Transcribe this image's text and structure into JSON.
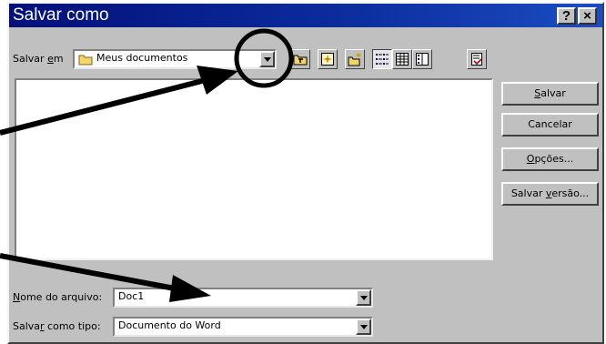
{
  "window": {
    "title": "Salvar como",
    "help_label": "?",
    "close_label": "×"
  },
  "location": {
    "label_pre": "Salvar ",
    "label_key": "e",
    "label_post": "m",
    "value": "Meus documentos"
  },
  "toolbar": {
    "icons": [
      "up-one-level-icon",
      "search-web-icon",
      "create-new-folder-icon",
      "list-view-icon",
      "details-view-icon",
      "properties-view-icon",
      "tools-icon"
    ]
  },
  "buttons": {
    "save": {
      "key": "S",
      "rest": "alvar"
    },
    "cancel": {
      "label": "Cancelar"
    },
    "options": {
      "key": "O",
      "rest": "pções..."
    },
    "save_version": {
      "pre": "Salvar ",
      "key": "v",
      "rest": "ersão..."
    }
  },
  "filename": {
    "label_key": "N",
    "label_rest": "ome do arquivo:",
    "value": "Doc1"
  },
  "filetype": {
    "label_pre": "Salva",
    "label_key": "r",
    "label_rest": " como tipo:",
    "value": "Documento do Word"
  },
  "annotation": {
    "arrow_color": "#000000"
  }
}
